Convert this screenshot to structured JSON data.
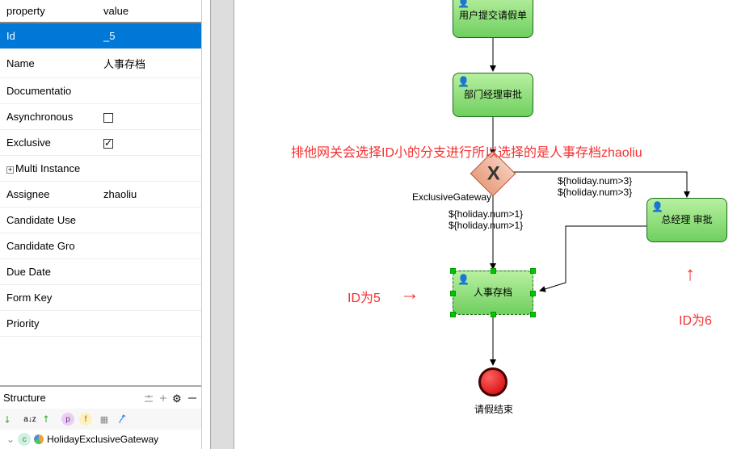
{
  "props": {
    "header_key": "property",
    "header_val": "value",
    "rows": [
      {
        "key": "Id",
        "val": "_5",
        "selected": true
      },
      {
        "key": "Name",
        "val": "人事存档"
      },
      {
        "key": "Documentatio",
        "val": ""
      },
      {
        "key": "Asynchronous",
        "val": "",
        "checkbox": true,
        "checked": false
      },
      {
        "key": "Exclusive",
        "val": "",
        "checkbox": true,
        "checked": true
      },
      {
        "key": "Multi Instance",
        "val": "",
        "expandable": true
      },
      {
        "key": "Assignee",
        "val": "zhaoliu"
      },
      {
        "key": "Candidate Use",
        "val": ""
      },
      {
        "key": "Candidate Gro",
        "val": ""
      },
      {
        "key": "Due Date",
        "val": ""
      },
      {
        "key": "Form Key",
        "val": ""
      },
      {
        "key": "Priority",
        "val": ""
      }
    ]
  },
  "structure": {
    "title": "Structure",
    "tree": {
      "label": "HolidayExclusiveGateway"
    }
  },
  "diagram": {
    "task_submit": "用户提交请假单",
    "task_manager": "部门经理审批",
    "task_archive": "人事存档",
    "task_ceo": "总经理 审批",
    "gateway_label": "ExclusiveGateway",
    "cond_left1": "${holiday.num>1}",
    "cond_left2": "${holiday.num>1}",
    "cond_right1": "${holiday.num>3}",
    "cond_right2": "${holiday.num>3}",
    "end_label": "请假结束"
  },
  "annotations": {
    "main": "排他网关会选择ID小的分支进行所以选择的是人事存档zhaoliu",
    "id5": "ID为5",
    "id6": "ID为6"
  }
}
